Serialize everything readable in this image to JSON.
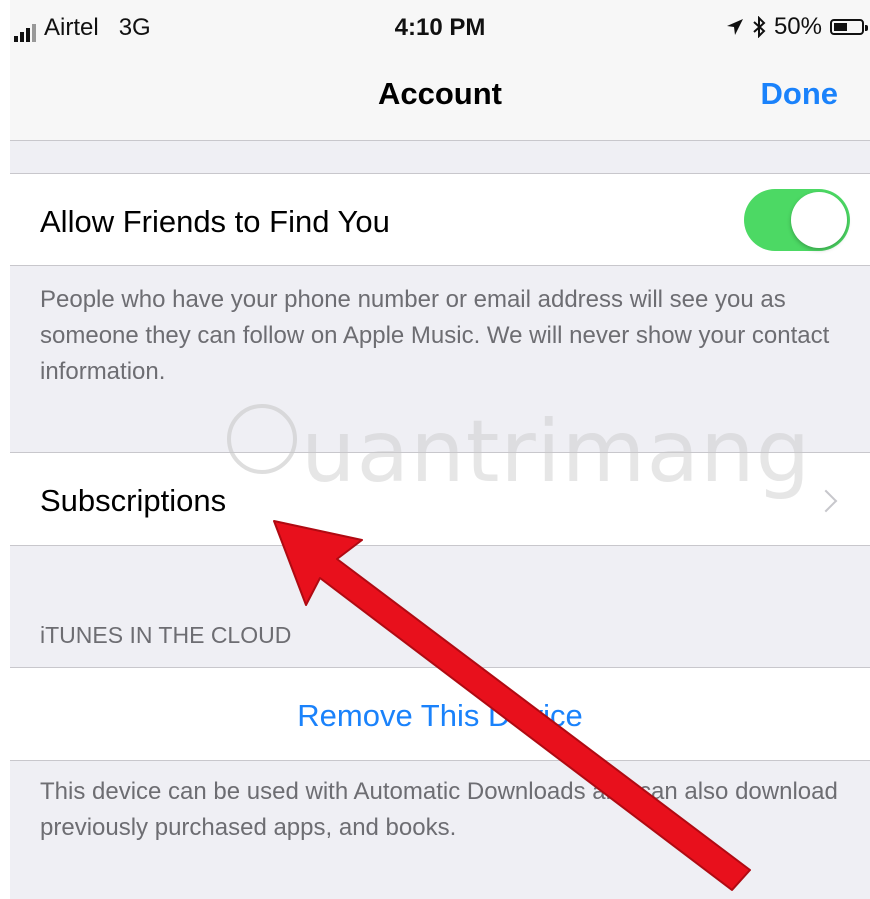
{
  "status_bar": {
    "carrier": "Airtel",
    "network": "3G",
    "time": "4:10 PM",
    "battery": "50%",
    "battery_level": 0.5
  },
  "nav": {
    "title": "Account",
    "done_label": "Done"
  },
  "friends": {
    "label": "Allow Friends to Find You",
    "toggle_on": true,
    "footer": "People who have your phone number or email address will see you as someone they can follow on Apple Music. We will never show your contact information."
  },
  "subscriptions": {
    "label": "Subscriptions"
  },
  "itunes_cloud": {
    "header": "iTUNES IN THE CLOUD",
    "action_label": "Remove This Device",
    "footer": "This device can be used with Automatic Downloads and can also download previously purchased apps, and books."
  },
  "watermark": {
    "text": "uantrimang"
  },
  "colors": {
    "accent": "#1a82fb",
    "toggle_on": "#4cd964",
    "arrow": "#e8101c",
    "background": "#efeff4"
  }
}
